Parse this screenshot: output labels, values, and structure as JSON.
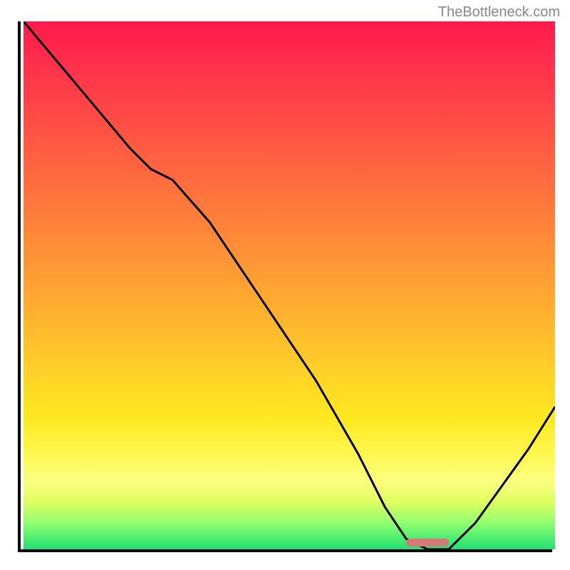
{
  "watermark": "TheBottleneck.com",
  "chart_data": {
    "type": "line",
    "title": "",
    "xlabel": "",
    "ylabel": "",
    "xlim": [
      0,
      1
    ],
    "ylim": [
      0,
      1
    ],
    "series": [
      {
        "name": "bottleneck-curve",
        "x": [
          0.0,
          0.05,
          0.1,
          0.15,
          0.2,
          0.24,
          0.28,
          0.35,
          0.45,
          0.55,
          0.63,
          0.68,
          0.72,
          0.76,
          0.8,
          0.85,
          0.9,
          0.95,
          1.0
        ],
        "values": [
          1.0,
          0.94,
          0.88,
          0.82,
          0.76,
          0.72,
          0.7,
          0.62,
          0.47,
          0.32,
          0.18,
          0.08,
          0.02,
          0.0,
          0.0,
          0.05,
          0.12,
          0.19,
          0.27
        ]
      }
    ],
    "marker": {
      "x_start": 0.72,
      "x_end": 0.8,
      "y": 0.0
    },
    "colors": {
      "curve": "#000000",
      "marker": "#d87878",
      "axis": "#000000"
    }
  }
}
